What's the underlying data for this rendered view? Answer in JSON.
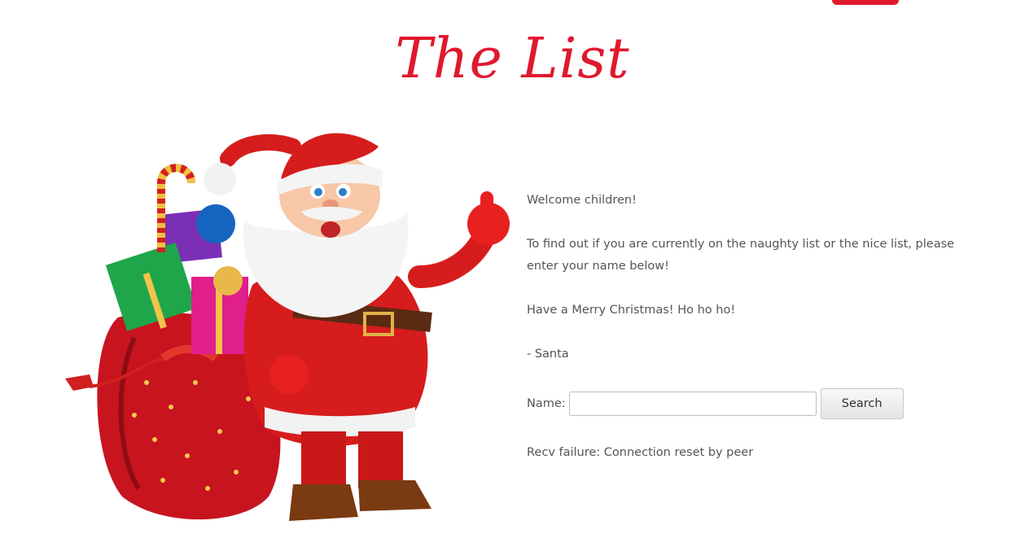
{
  "page": {
    "title": "The List"
  },
  "intro": {
    "greeting": "Welcome children!",
    "instructions": "To find out if you are currently on the naughty list or the nice list, please enter your name below!",
    "wishes": "Have a Merry Christmas! Ho ho ho!",
    "signature": "- Santa"
  },
  "form": {
    "name_label": "Name:",
    "name_value": "",
    "search_label": "Search"
  },
  "result": {
    "message": "Recv failure: Connection reset by peer"
  },
  "colors": {
    "accent": "#e0182d",
    "text": "#555555"
  },
  "images": {
    "santa": "santa-claus-with-gift-sack-illustration"
  }
}
